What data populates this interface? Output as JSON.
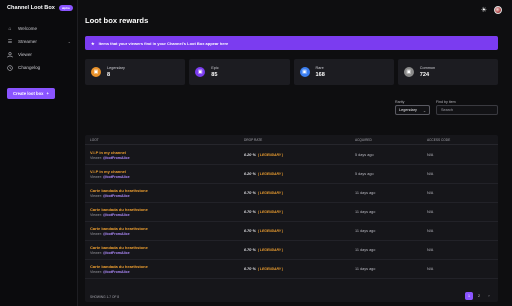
{
  "app": {
    "brand": "Channel Loot Box",
    "badge": "alpha"
  },
  "sidebar": {
    "items": [
      {
        "label": "Welcome",
        "icon": "home-icon"
      },
      {
        "label": "Streamer",
        "icon": "settings-sliders-icon",
        "expandable": true
      },
      {
        "label": "Viewer",
        "icon": "user-icon"
      },
      {
        "label": "Changelog",
        "icon": "clock-icon"
      }
    ],
    "create_label": "Create loot box"
  },
  "header": {
    "theme_icon": "sun-icon",
    "avatar": "avatar"
  },
  "main": {
    "title": "Loot box rewards",
    "banner": "Items that your viewers find in your Channel's Loot Box appear here",
    "stats": [
      {
        "label": "Legendary",
        "value": "8",
        "color": "#e8912a",
        "icon": "box-icon"
      },
      {
        "label": "Epic",
        "value": "85",
        "color": "#7b3cf0",
        "icon": "box-icon"
      },
      {
        "label": "Rare",
        "value": "168",
        "color": "#3a7ef0",
        "icon": "box-icon"
      },
      {
        "label": "Common",
        "value": "724",
        "color": "#8a8a8a",
        "icon": "box-icon"
      }
    ],
    "filters": {
      "rarity_label": "Rarity",
      "rarity_value": "Legendary",
      "search_label": "Find by item",
      "search_placeholder": "Search"
    },
    "table": {
      "headers": [
        "LOOT",
        "DROP RATE",
        "ACQUIRED",
        "ACCESS CODE"
      ],
      "rows": [
        {
          "name": "V.I.P in my channel",
          "viewer_prefix": "Viewer:",
          "viewer": "@botFromAlice",
          "rate": "0.20 %",
          "rarity": "( LEGENDARY )",
          "acquired": "5 days ago",
          "code": "N/A"
        },
        {
          "name": "V.I.P in my channel",
          "viewer_prefix": "Viewer:",
          "viewer": "@botFromAlice",
          "rate": "0.20 %",
          "rarity": "( LEGENDARY )",
          "acquired": "5 days ago",
          "code": "N/A"
        },
        {
          "name": "Carte bandada du hearthstone",
          "viewer_prefix": "Viewer:",
          "viewer": "@botFromAlice",
          "rate": "0.70 %",
          "rarity": "( LEGENDARY )",
          "acquired": "11 days ago",
          "code": "N/A"
        },
        {
          "name": "Carte bandada du hearthstone",
          "viewer_prefix": "Viewer:",
          "viewer": "@botFromAlice",
          "rate": "0.70 %",
          "rarity": "( LEGENDARY )",
          "acquired": "11 days ago",
          "code": "N/A"
        },
        {
          "name": "Carte bandada du hearthstone",
          "viewer_prefix": "Viewer:",
          "viewer": "@botFromAlice",
          "rate": "0.70 %",
          "rarity": "( LEGENDARY )",
          "acquired": "11 days ago",
          "code": "N/A"
        },
        {
          "name": "Carte bandada du hearthstone",
          "viewer_prefix": "Viewer:",
          "viewer": "@botFromAlice",
          "rate": "0.70 %",
          "rarity": "( LEGENDARY )",
          "acquired": "11 days ago",
          "code": "N/A"
        },
        {
          "name": "Carte bandada du hearthstone",
          "viewer_prefix": "Viewer:",
          "viewer": "@botFromAlice",
          "rate": "0.70 %",
          "rarity": "( LEGENDARY )",
          "acquired": "11 days ago",
          "code": "N/A"
        }
      ],
      "showing": "SHOWING 1-7 OF 8",
      "pages": [
        "1",
        "2"
      ],
      "active_page": "1"
    }
  }
}
